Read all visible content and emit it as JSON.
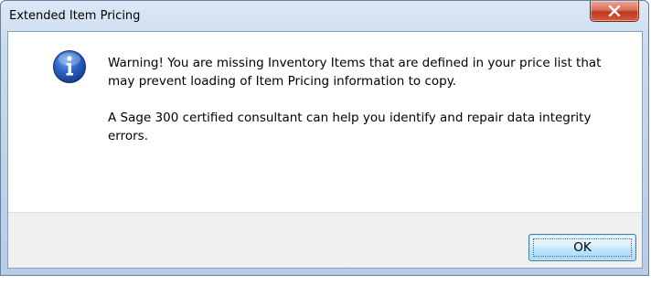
{
  "window": {
    "title": "Extended Item Pricing",
    "close_icon": "close-icon"
  },
  "dialog": {
    "icon": "info-icon",
    "message_line1": "Warning! You are missing Inventory Items that are defined in your price list that may prevent loading of Item Pricing information to copy.",
    "message_line2": "A Sage 300 certified consultant can help you identify and repair data integrity errors."
  },
  "buttons": {
    "ok_label": "OK"
  },
  "colors": {
    "titlebar": "#c9dbee",
    "close_button": "#c1371e",
    "info_icon": "#1f5cb8",
    "footer": "#f0f0f0",
    "ok_border": "#3c7fb1"
  }
}
